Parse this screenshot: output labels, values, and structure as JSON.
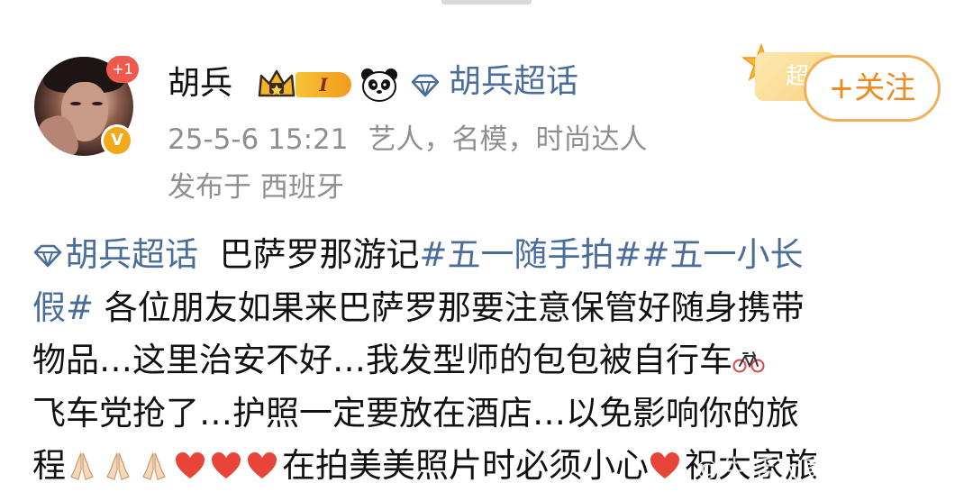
{
  "profile": {
    "username": "胡兵",
    "notification_count": "+1",
    "level_badge": "I",
    "supertopic_link": "胡兵超话",
    "follow_button": "+关注",
    "supertopic_tag": "超",
    "timestamp": "25-5-6 15:21",
    "bio": "艺人，名模，时尚达人",
    "location": "发布于 西班牙",
    "verified_icon": "verified-v-icon",
    "crown_icon": "crown-icon",
    "panda_icon": "panda-icon",
    "diamond_icon": "diamond-icon"
  },
  "post": {
    "lines": {
      "l1": {
        "topic": "胡兵超话",
        "text": "  巴萨罗那游记",
        "hashtag1": "#五一随手拍#",
        "hashtag2": "#五一小长"
      },
      "l2": {
        "hashtag": "假#",
        "text": " 各位朋友如果来巴萨罗那要注意保管好随身携带"
      },
      "l3": {
        "text": "物品…这里治安不好…我发型师的包包被自行车"
      },
      "l4": {
        "text": "飞车党抢了…护照一定要放在酒店…以免影响你的旅"
      },
      "l5": {
        "start": "程",
        "text": "在拍美美照片时必须小心",
        "end": "祝大家旅"
      }
    },
    "emojis": [
      "pray",
      "pray",
      "pray",
      "heart",
      "heart",
      "heart",
      "bicycle",
      "heart"
    ]
  },
  "colors": {
    "link": "#4a6d9b",
    "follow_orange": "#ee8a1f",
    "meta_gray": "#8f8f8f",
    "heart_red": "#e8443a"
  },
  "watermark": "©生活大家旅"
}
